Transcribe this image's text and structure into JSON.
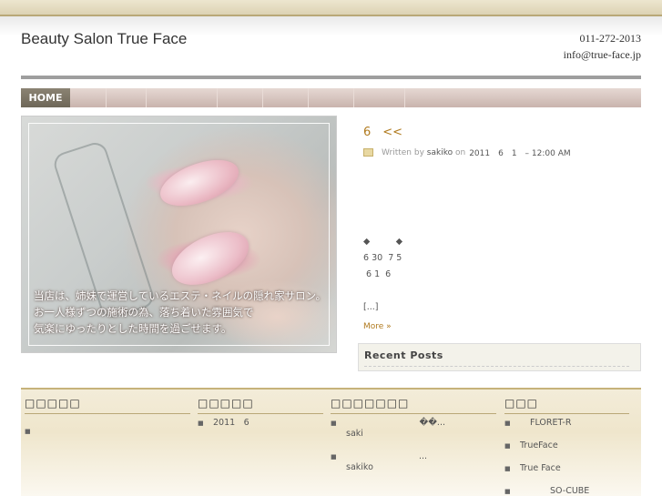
{
  "header": {
    "title": "Beauty Salon True Face",
    "phone": "011-272-2013",
    "email": "info@true-face.jp"
  },
  "nav": {
    "home_label": "HOME"
  },
  "hero": {
    "caption_line1": "当店は、姉妹で運営しているエステ・ネイルの隠れ家サロン。",
    "caption_line2": "お一人様ずつの施術の為、落ち着いた雰囲気で",
    "caption_line3": "気楽にゆったりとした時間を過ごせます。"
  },
  "post": {
    "title": "6　<<",
    "meta_prefix": "Written by",
    "author": "sakiko",
    "meta_on": "on",
    "date": "2011　6　1　– 12:00 AM",
    "line1": "◆　　　◆",
    "line2": "6 30  7 5",
    "line3": " 6 1  6",
    "excerpt_end": "[...]",
    "more": "More »"
  },
  "recent_posts": {
    "title": "Recent Posts"
  },
  "footer": {
    "col1_title": "□□□□□",
    "col2_title": "□□□□□",
    "col3_title": "□□□□□□□",
    "col4_title": "□□□",
    "col1_items": [
      ""
    ],
    "col2_items": [
      "2011　6"
    ],
    "col3_items": [
      "��...",
      "saki",
      "...",
      "sakiko"
    ],
    "col4_items": [
      "FLORET-R",
      "TrueFace",
      "True Face",
      "SO-CUBE"
    ]
  }
}
